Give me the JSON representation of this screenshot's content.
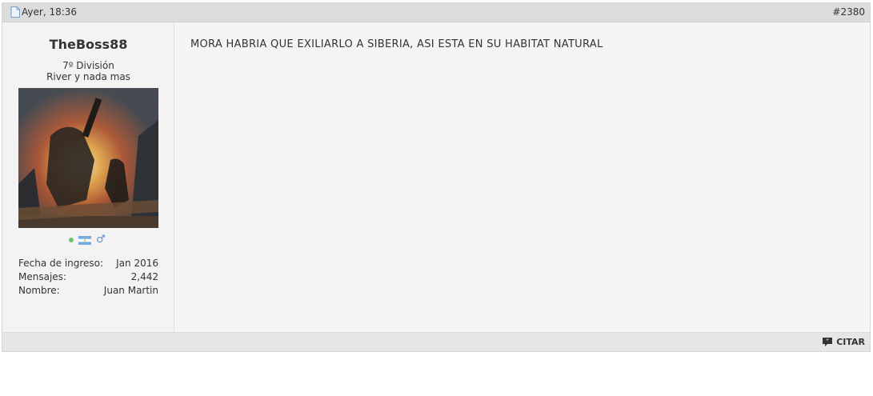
{
  "post": {
    "date": "Ayer, 18:36",
    "number": "#2380"
  },
  "user": {
    "name": "TheBoss88",
    "rank": "7º División",
    "title": "River y nada mas",
    "online_status": "online",
    "flag": "argentina-flag-icon",
    "gender": "male-icon",
    "stats": [
      {
        "label": "Fecha de ingreso:",
        "value": "Jan 2016"
      },
      {
        "label": "Mensajes:",
        "value": "2,442"
      },
      {
        "label": "Nombre:",
        "value": "Juan Martin"
      }
    ]
  },
  "message": "MORA HABRIA QUE EXILIARLO A SIBERIA, ASI ESTA EN SU HABITAT NATURAL",
  "footer": {
    "quote_label": "CITAR"
  }
}
